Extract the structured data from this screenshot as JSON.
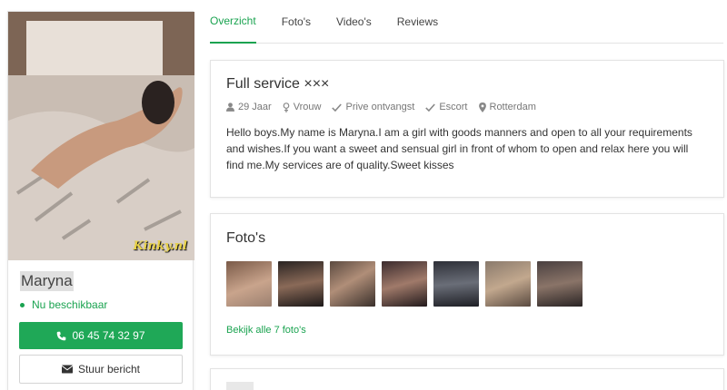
{
  "sidebar": {
    "watermark": "Kinky.nl",
    "name": "Maryna",
    "status": "Nu beschikbaar",
    "phone_label": "06 45 74 32 97",
    "message_label": "Stuur bericht"
  },
  "tabs": [
    {
      "label": "Overzicht",
      "active": true
    },
    {
      "label": "Foto's",
      "active": false
    },
    {
      "label": "Video's",
      "active": false
    },
    {
      "label": "Reviews",
      "active": false
    }
  ],
  "about": {
    "title": "Full service ×××",
    "meta": [
      {
        "icon": "user-icon",
        "text": "29 Jaar"
      },
      {
        "icon": "gender-icon",
        "text": "Vrouw"
      },
      {
        "icon": "check-icon",
        "text": "Prive ontvangst"
      },
      {
        "icon": "check-icon",
        "text": "Escort"
      },
      {
        "icon": "map-pin-icon",
        "text": "Rotterdam"
      }
    ],
    "description": "Hello boys.My name is Maryna.I am a girl with goods manners and open to all your requirements and wishes.If you want a sweet and sensual girl in front of whom to open and relax here you will find me.My services are of quality.Sweet kisses"
  },
  "photos": {
    "title": "Foto's",
    "view_all_label": "Bekijk alle 7 foto's"
  },
  "colors": {
    "accent": "#1aa350",
    "button_green": "#1fa857"
  }
}
